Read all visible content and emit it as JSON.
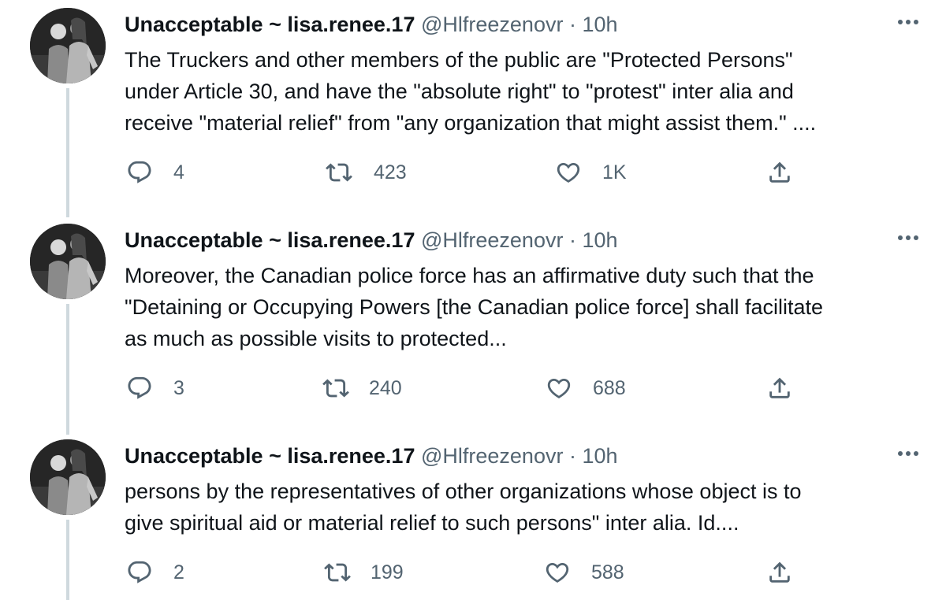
{
  "tweets": [
    {
      "name": "Unacceptable ~ lisa.renee.17",
      "handle": "@Hlfreezenovr",
      "separator": "·",
      "time": "10h",
      "lines": [
        "The Truckers and other members of the public are \"Protected Persons\"",
        "under Article 30, and have the \"absolute right\" to \"protest\" inter alia and",
        "receive \"material relief\" from \"any organization that might assist them.\" ...."
      ],
      "replies": "4",
      "retweets": "423",
      "likes": "1K"
    },
    {
      "name": "Unacceptable ~ lisa.renee.17",
      "handle": "@Hlfreezenovr",
      "separator": "·",
      "time": "10h",
      "lines": [
        "Moreover, the Canadian police force has an affirmative duty such that the",
        "\"Detaining or Occupying Powers [the Canadian police force] shall facilitate",
        "as much as possible visits to protected..."
      ],
      "replies": "3",
      "retweets": "240",
      "likes": "688"
    },
    {
      "name": "Unacceptable ~ lisa.renee.17",
      "handle": "@Hlfreezenovr",
      "separator": "·",
      "time": "10h",
      "lines": [
        "persons by the representatives of other organizations whose object is to",
        "give spiritual aid or material relief to such persons\" inter alia. Id...."
      ],
      "replies": "2",
      "retweets": "199",
      "likes": "588"
    }
  ],
  "icons": {
    "reply": "reply-icon",
    "retweet": "retweet-icon",
    "like": "like-icon",
    "share": "share-icon",
    "more": "more-icon",
    "avatar": "avatar-photo"
  },
  "colors": {
    "text": "#0f1419",
    "secondary": "#536471",
    "thread_line": "#cfd9de",
    "background": "#ffffff"
  }
}
